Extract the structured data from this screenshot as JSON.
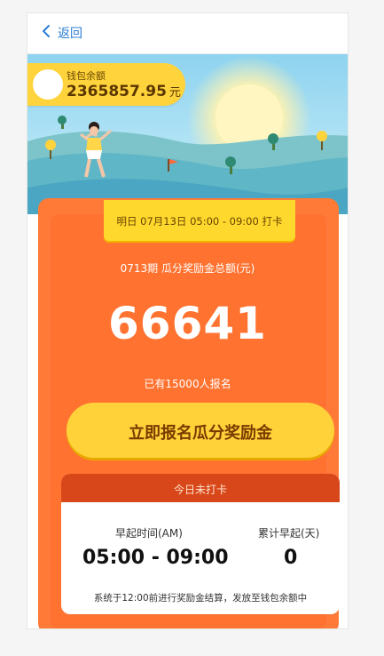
{
  "nav": {
    "back_label": "返回"
  },
  "wallet": {
    "label": "钱包余额",
    "amount": "2365857.95",
    "unit": "元"
  },
  "event": {
    "schedule": "明日  07月13日 05:00 - 09:00 打卡",
    "pool_title": "0713期 瓜分奖励金总额(元)",
    "pool_amount": "66641",
    "participants": "已有15000人报名",
    "cta_label": "立即报名瓜分奖励金"
  },
  "checkin": {
    "status": "今日未打卡",
    "time_label": "早起时间(AM)",
    "time_value": "05:00 - 09:00",
    "days_label": "累计早起(天)",
    "days_value": "0",
    "note": "系统于12:00前进行奖励金结算，发放至钱包余额中"
  },
  "colors": {
    "accent_blue": "#2b7cd3",
    "card_orange": "#ff7230",
    "cta_yellow": "#ffd23a",
    "panel_head": "#d8471a"
  }
}
